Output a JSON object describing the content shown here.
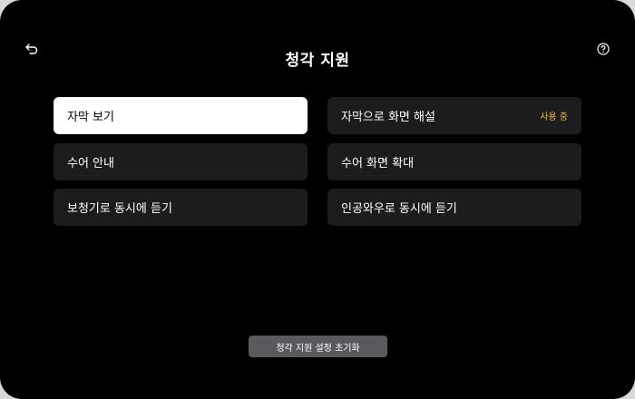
{
  "header": {
    "title": "청각 지원",
    "back_icon": "back-arrow-icon",
    "help_icon": "help-icon"
  },
  "options": {
    "left": [
      {
        "label": "자막 보기",
        "selected": true
      },
      {
        "label": "수어 안내",
        "selected": false
      },
      {
        "label": "보청기로 동시에 듣기",
        "selected": false
      }
    ],
    "right": [
      {
        "label": "자막으로 화면 해설",
        "badge": "사용 중",
        "selected": false
      },
      {
        "label": "수어 화면 확대",
        "selected": false
      },
      {
        "label": "인공와우로 동시에 듣기",
        "selected": false
      }
    ]
  },
  "footer": {
    "reset_label": "청각 지원 설정 초기화"
  },
  "colors": {
    "background": "#000000",
    "tile": "#1c1c1e",
    "selected_tile": "#ffffff",
    "badge": "#f5c242",
    "reset_button": "#5a5a5e"
  }
}
